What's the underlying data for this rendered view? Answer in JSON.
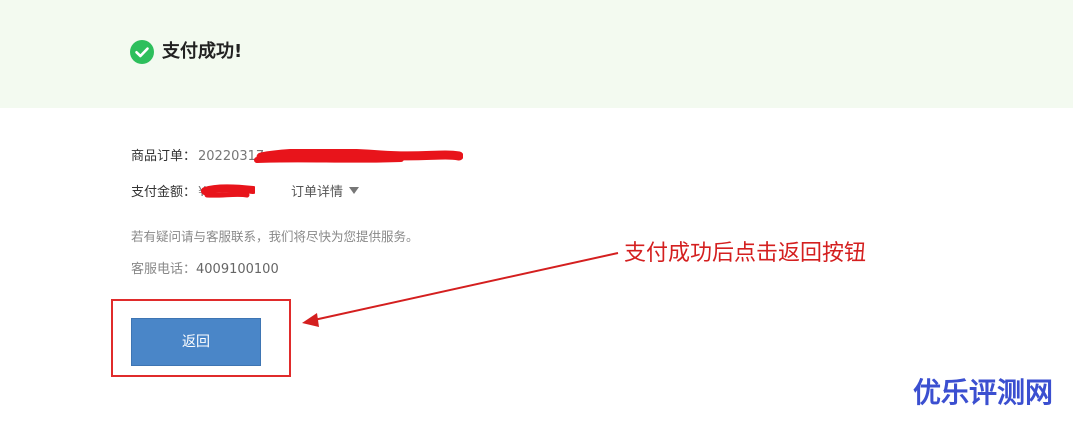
{
  "success": {
    "icon": "check-circle-icon",
    "title": "支付成功!"
  },
  "order": {
    "label": "商品订单：",
    "value": "20220317"
  },
  "payment": {
    "label": "支付金额：",
    "value": "¥"
  },
  "order_detail": {
    "label": "订单详情",
    "icon": "caret-down-icon"
  },
  "service": {
    "note": "若有疑问请与客服联系，我们将尽快为您提供服务。",
    "phone_label": "客服电话：",
    "phone_value": "4009100100"
  },
  "back_button": {
    "label": "返回"
  },
  "annotation": {
    "text": "支付成功后点击返回按钮"
  },
  "watermark": {
    "text": "优乐评测网"
  },
  "colors": {
    "success_green": "#2dbf5c",
    "banner_bg": "#f3faf0",
    "button_blue": "#4a86c8",
    "annotation_red": "#d41f1f",
    "watermark_blue": "#3b4fd0"
  }
}
